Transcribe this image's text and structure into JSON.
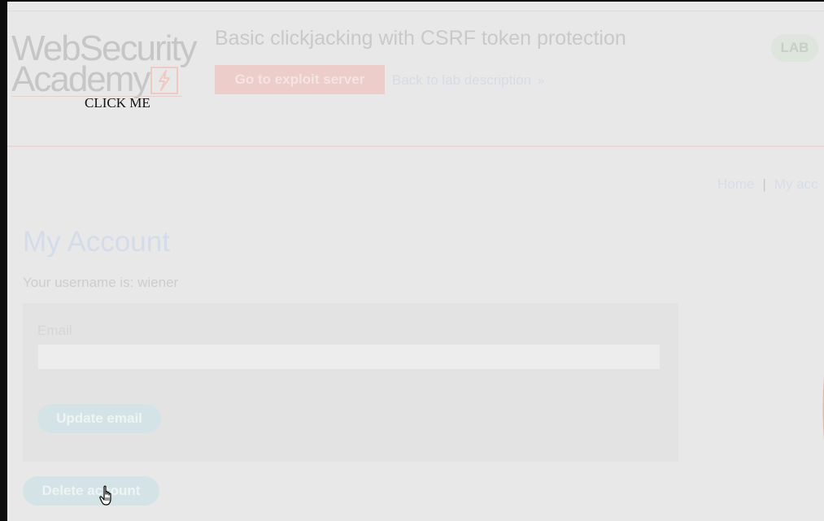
{
  "logo": {
    "line1": "WebSecurity",
    "line2": "Academy"
  },
  "header": {
    "title": "Basic clickjacking with CSRF token protection",
    "exploit_button": "Go to exploit server",
    "back_link": "Back to lab description",
    "back_chevron": "»",
    "lab_badge": "LAB"
  },
  "decoy": {
    "label": "CLICK ME"
  },
  "nav": {
    "home": "Home",
    "separator": "|",
    "my_account": "My acc"
  },
  "main": {
    "title": "My Account",
    "username_line": "Your username is: wiener",
    "email_label": "Email",
    "email_value": "",
    "update_button": "Update email",
    "delete_button": "Delete account"
  },
  "colors": {
    "accent_orange": "#ff6633",
    "button_teal": "#70d2da",
    "link_blue": "#0071bc"
  },
  "icons": {
    "logo_badge": "lightning-bolt-icon",
    "cursor": "hand-pointer-cursor-icon"
  }
}
